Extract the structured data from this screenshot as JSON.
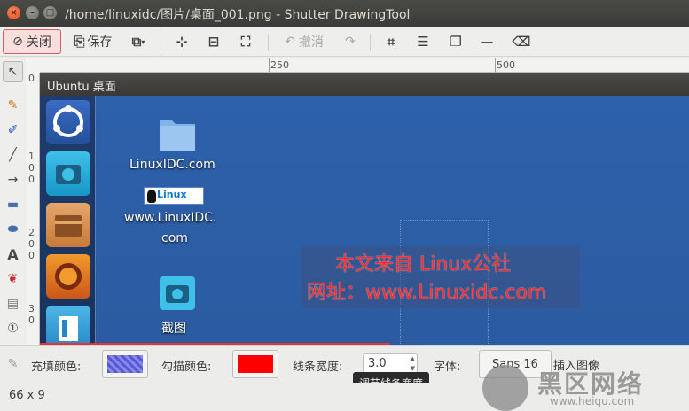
{
  "window": {
    "title": "/home/linuxidc/图片/桌面_001.png - Shutter DrawingTool"
  },
  "toolbar": {
    "close_label": "关闭",
    "save_label": "保存",
    "undo_label": "撤消"
  },
  "ruler": {
    "h_labels": [
      "250",
      "500"
    ],
    "v_labels": [
      "0",
      "1",
      "0",
      "0",
      "2",
      "0",
      "0",
      "3",
      "0"
    ]
  },
  "desktop": {
    "title": "Ubuntu 桌面",
    "icons": [
      {
        "label": "LinuxIDC.com"
      },
      {
        "label_line1": "www.LinuxIDC.",
        "label_line2": "com",
        "logo_text": "Linux"
      },
      {
        "label": "截图"
      }
    ],
    "watermark": {
      "line1": "本文来自 Linux公社",
      "line2": "网址：www.Linuxidc.com"
    }
  },
  "options": {
    "fill_label": "充填颜色:",
    "fill_color": "#5a5ad8",
    "stroke_label": "勾描颜色:",
    "stroke_color": "#ff0000",
    "width_label": "线条宽度:",
    "width_value": "3.0",
    "font_label": "字体:",
    "font_value": "Sans 16",
    "insert_label": "插入图像"
  },
  "tooltip": "调节线条宽度",
  "status": {
    "size": "66 x 9"
  },
  "brand": {
    "name": "黑区网络",
    "url": "www.heiqu.com"
  }
}
